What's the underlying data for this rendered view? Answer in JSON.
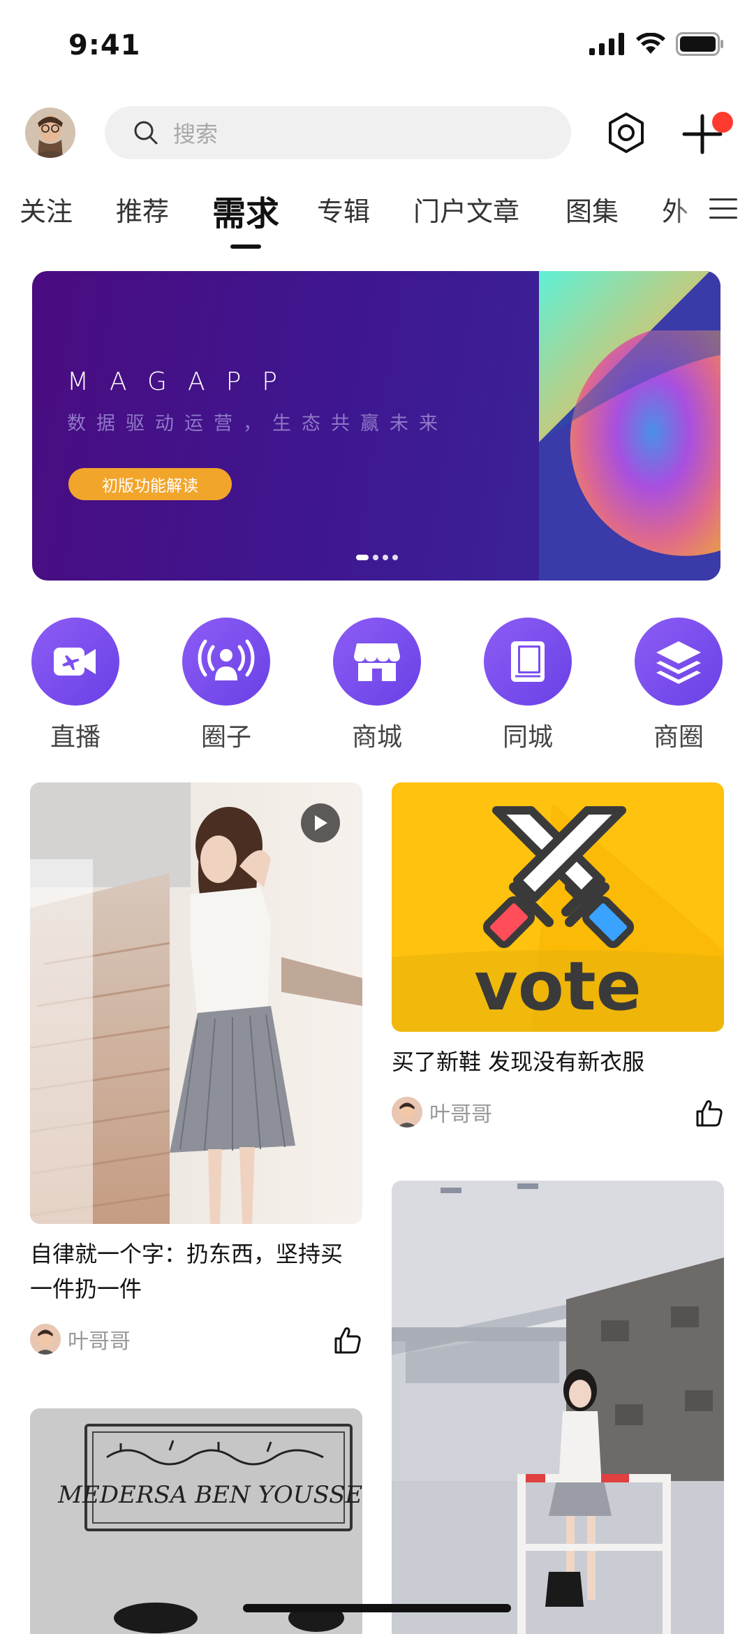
{
  "status_bar": {
    "time": "9:41"
  },
  "header": {
    "search_placeholder": "搜索"
  },
  "tabs": [
    {
      "label": "关注"
    },
    {
      "label": "推荐"
    },
    {
      "label": "需求",
      "active": true
    },
    {
      "label": "专辑"
    },
    {
      "label": "门户文章"
    },
    {
      "label": "图集"
    },
    {
      "label": "外"
    }
  ],
  "banner": {
    "title": "MAGAPP",
    "subtitle": "数据驱动运营，生态共赢未来",
    "button": "初版功能解读",
    "page_count": 4,
    "current_page": 1
  },
  "categories": [
    {
      "label": "直播",
      "icon": "live-camera-icon"
    },
    {
      "label": "圈子",
      "icon": "broadcast-icon"
    },
    {
      "label": "商城",
      "icon": "store-icon"
    },
    {
      "label": "同城",
      "icon": "book-icon"
    },
    {
      "label": "商圈",
      "icon": "layers-icon"
    }
  ],
  "feed": {
    "left": [
      {
        "title": "自律就一个字：扔东西，坚持买一件扔一件",
        "author": "叶哥哥",
        "is_video": true
      },
      {
        "image_text": "MEDERSA BEN YOUSSEF"
      }
    ],
    "right": [
      {
        "title": "买了新鞋 发现没有新衣服",
        "author": "叶哥哥",
        "image_text": "vote"
      },
      {
        "title": ""
      }
    ]
  },
  "colors": {
    "accent_purple": "#7b4ff0",
    "banner_button": "#f2a52b",
    "notification_dot": "#ff3b30",
    "vote_yellow": "#ffc20e"
  }
}
